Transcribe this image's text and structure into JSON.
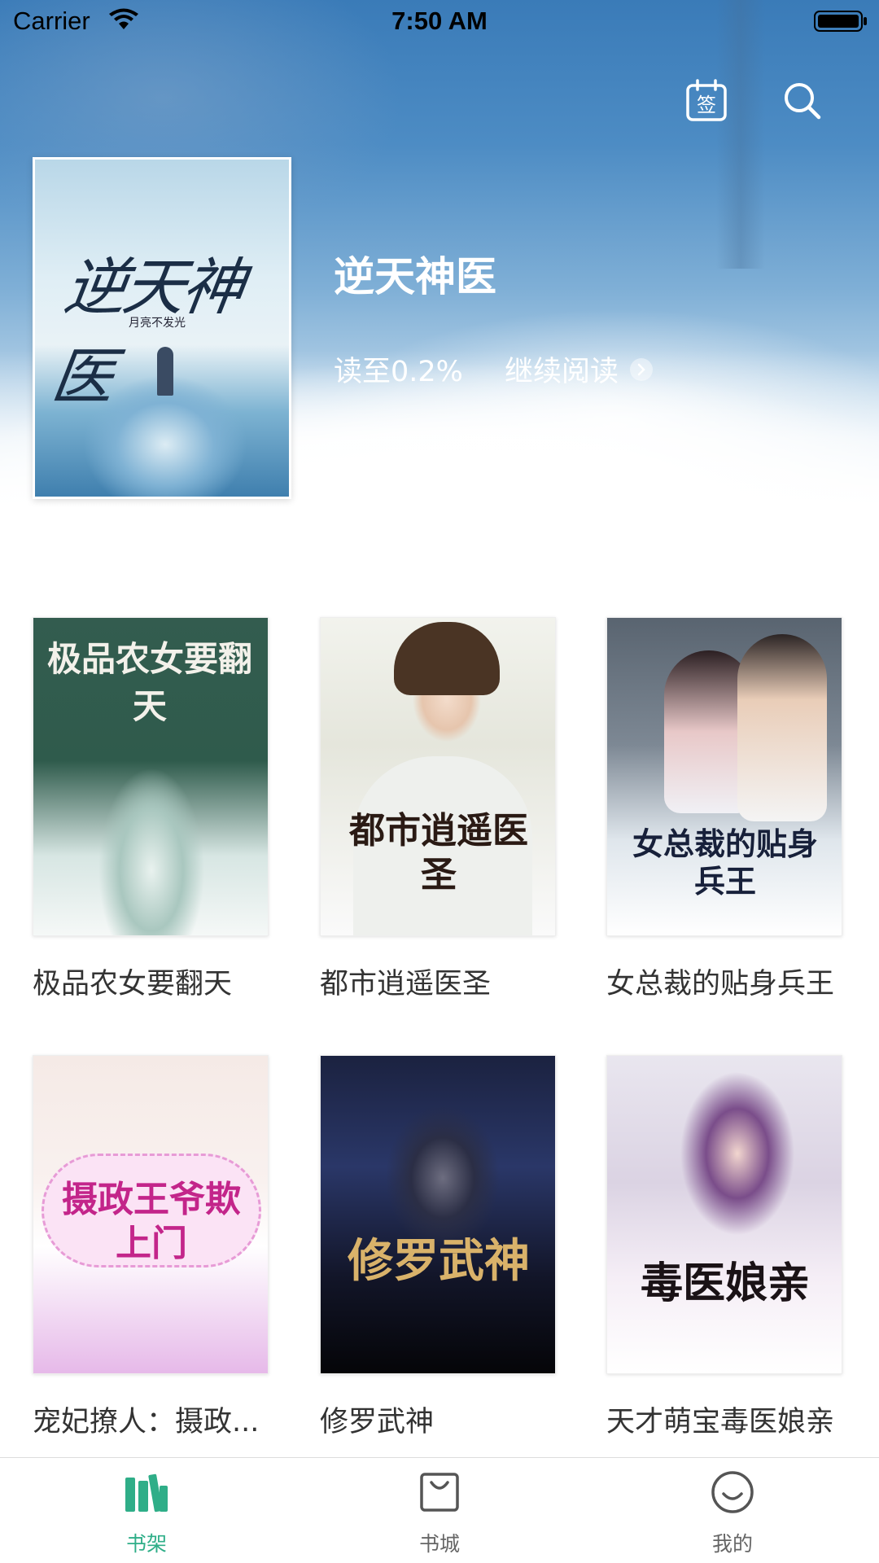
{
  "status_bar": {
    "carrier": "Carrier",
    "time": "7:50 AM"
  },
  "header": {
    "signin_icon": "calendar-sign-icon",
    "signin_label": "签",
    "search_icon": "search-icon"
  },
  "featured": {
    "title": "逆天神医",
    "progress": "读至0.2%",
    "continue_label": "继续阅读",
    "cover_title": "逆天神医",
    "cover_author": "月亮不发光"
  },
  "shelf": {
    "books": [
      {
        "name": "极品农女要翻天",
        "cover_text": "极品农女要翻天"
      },
      {
        "name": "都市逍遥医圣",
        "cover_text": "都市逍遥医圣"
      },
      {
        "name": "女总裁的贴身兵王",
        "cover_text": "女总裁的贴身兵王"
      },
      {
        "name": "宠妃撩人：摄政...",
        "cover_text": "摄政王爷欺上门"
      },
      {
        "name": "修罗武神",
        "cover_text": "修罗武神"
      },
      {
        "name": "天才萌宝毒医娘亲",
        "cover_text": "毒医娘亲"
      }
    ]
  },
  "tab_bar": {
    "tabs": [
      {
        "label": "书架",
        "icon": "bookshelf-icon",
        "active": true
      },
      {
        "label": "书城",
        "icon": "shopping-bag-icon",
        "active": false
      },
      {
        "label": "我的",
        "icon": "smiley-icon",
        "active": false
      }
    ]
  },
  "colors": {
    "accent": "#2fae88",
    "hero_blue": "#3a7bb8",
    "tab_inactive": "#666666"
  }
}
